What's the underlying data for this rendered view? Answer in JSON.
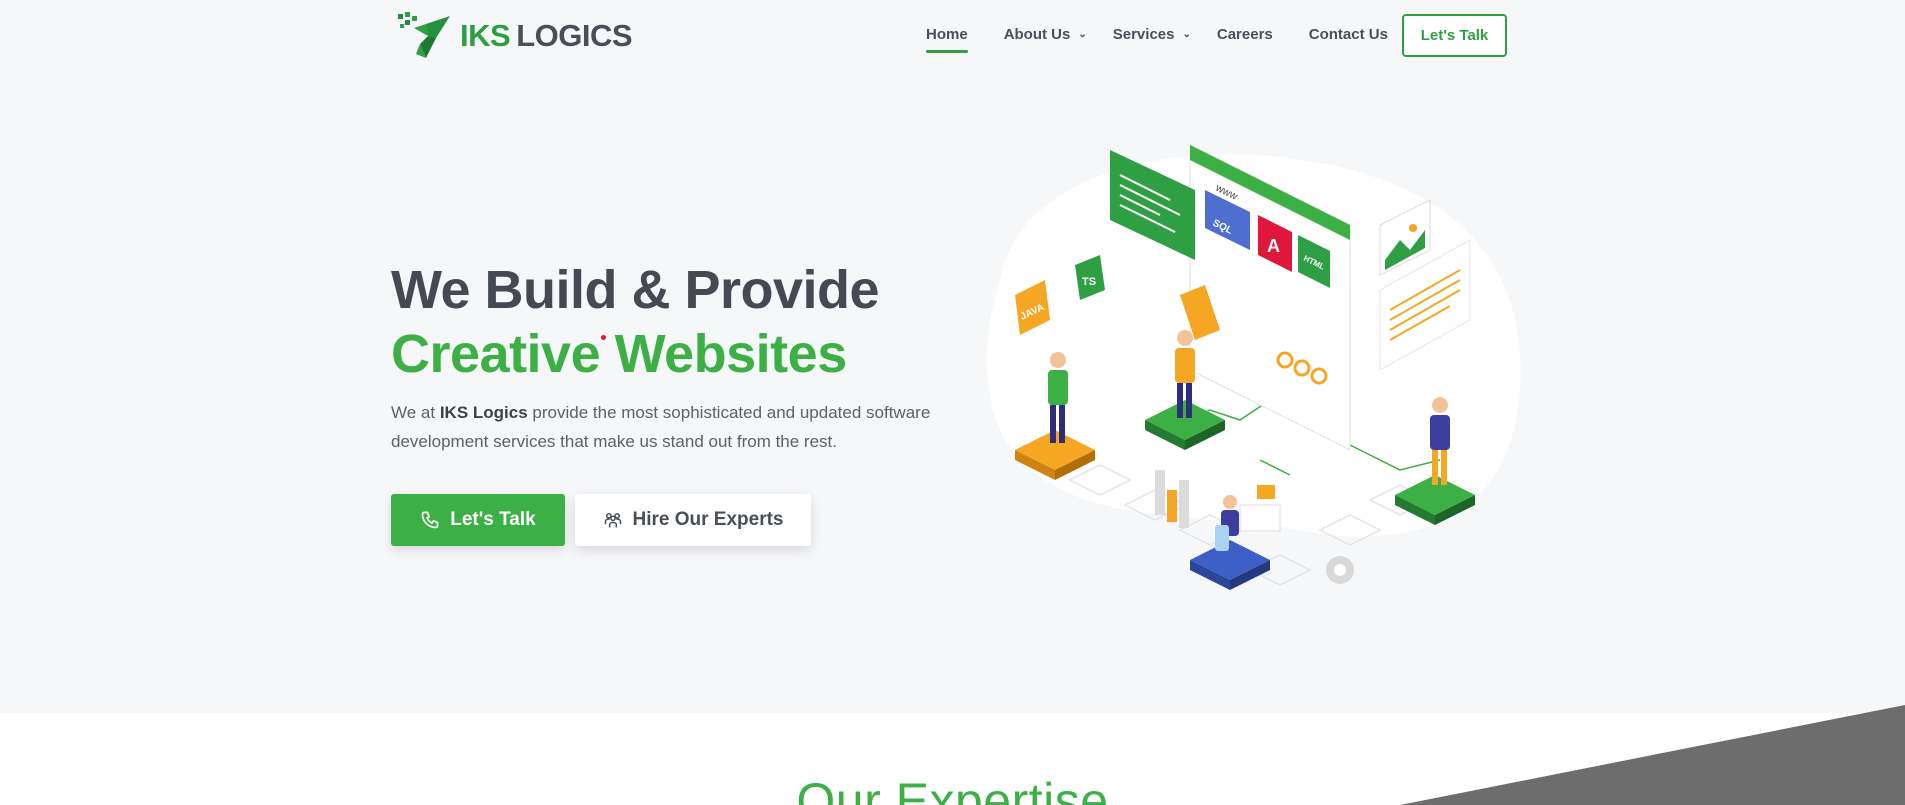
{
  "header": {
    "logo_primary": "IKS",
    "logo_secondary": "LOGICS",
    "nav": [
      {
        "label": "Home",
        "active": true,
        "dropdown": false
      },
      {
        "label": "About Us",
        "active": false,
        "dropdown": true
      },
      {
        "label": "Services",
        "active": false,
        "dropdown": true
      },
      {
        "label": "Careers",
        "active": false,
        "dropdown": false
      },
      {
        "label": "Contact Us",
        "active": false,
        "dropdown": false
      }
    ],
    "cta_label": "Let's Talk"
  },
  "hero": {
    "title_line1": "We Build & Provide",
    "title_line2": "Creative Websites",
    "desc_prefix": "We at ",
    "desc_brand": "IKS Logics",
    "desc_suffix": " provide the most sophisticated and updated software development services that make us stand out from the rest.",
    "primary_button": "Let's Talk",
    "secondary_button": "Hire Our Experts"
  },
  "illustration": {
    "tags": [
      "JAVA",
      "TS",
      "SQL",
      "HTML",
      "WWW"
    ]
  },
  "section": {
    "heading": "Our Expertise"
  },
  "colors": {
    "brand_green": "#3cb044",
    "dark_text": "#454a52",
    "background": "#f6f7f9"
  }
}
